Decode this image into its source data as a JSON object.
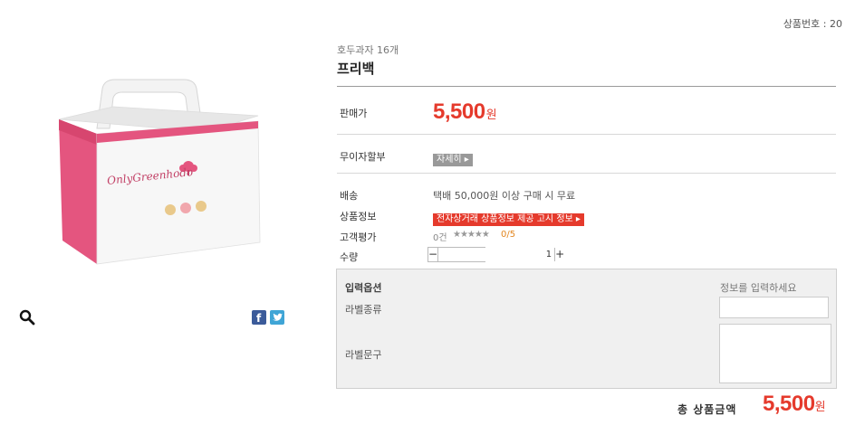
{
  "header": {
    "product_no_label": "상품번호 : 20"
  },
  "product": {
    "category": "호두과자 16개",
    "name": "프리백",
    "image_icon": "product-box-image",
    "box_brand_text": "OnlyGreenhodo"
  },
  "price": {
    "label": "판매가",
    "value": "5,500",
    "unit": "원"
  },
  "installment": {
    "label": "무이자할부",
    "detail_button": "자세히 ▸"
  },
  "shipping": {
    "label": "배송",
    "text": "택배 50,000원 이상 구매 시 무료"
  },
  "product_info": {
    "label": "상품정보",
    "button": "전자상거래 상품정보 제공 고시 정보 ▸"
  },
  "review": {
    "label": "고객평가",
    "count": "0건",
    "stars": "★★★★★",
    "score": "0/5"
  },
  "quantity": {
    "label": "수량",
    "minus": "−",
    "plus": "+",
    "value": "1"
  },
  "options": {
    "heading": "입력옵션",
    "hint": "정보를 입력하세요",
    "label_type": "라벨종류",
    "label_text": "라벨문구"
  },
  "total": {
    "label": "총 상품금액",
    "value": "5,500",
    "unit": "원"
  },
  "icons": {
    "zoom": "magnifier-icon",
    "facebook": "facebook-icon",
    "twitter": "twitter-icon"
  },
  "colors": {
    "accent": "#e53a2c",
    "box_pink": "#e4557f",
    "score": "#e2861f"
  }
}
